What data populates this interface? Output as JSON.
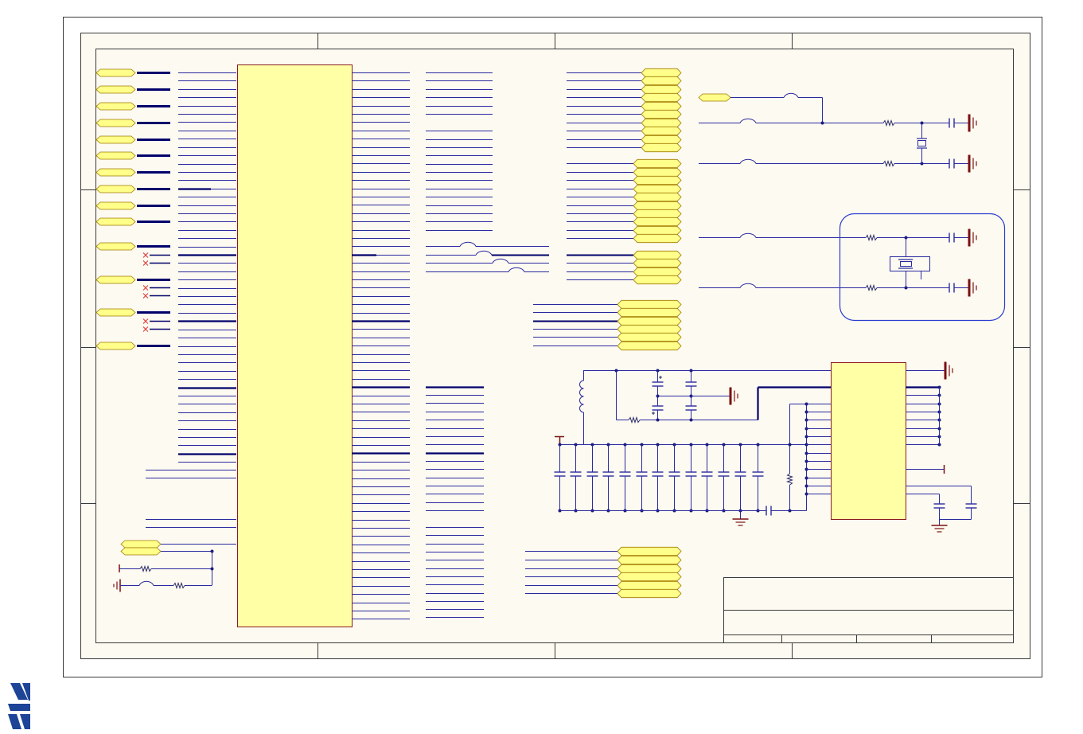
{
  "colors": {
    "page": "#ffffff",
    "sheet": "#fdfaf1",
    "frame": "#3a3a3a",
    "wire": "#2a2aa0",
    "bus": "#00006b",
    "resistor": "#2a2a6a",
    "ic_fill": "#ffffa6",
    "ic_outline": "#8a1c1c",
    "net_label_fill": "#ffff8a",
    "net_label_outline": "#a07a00",
    "ground": "#7a1010",
    "no_connect": "#e03030",
    "highlight_box": "#2a3cd0",
    "junction": "#1c1c80",
    "logo": "#1d4496"
  },
  "logo": {
    "icon": "st-logo-icon",
    "lettering": "ST"
  }
}
